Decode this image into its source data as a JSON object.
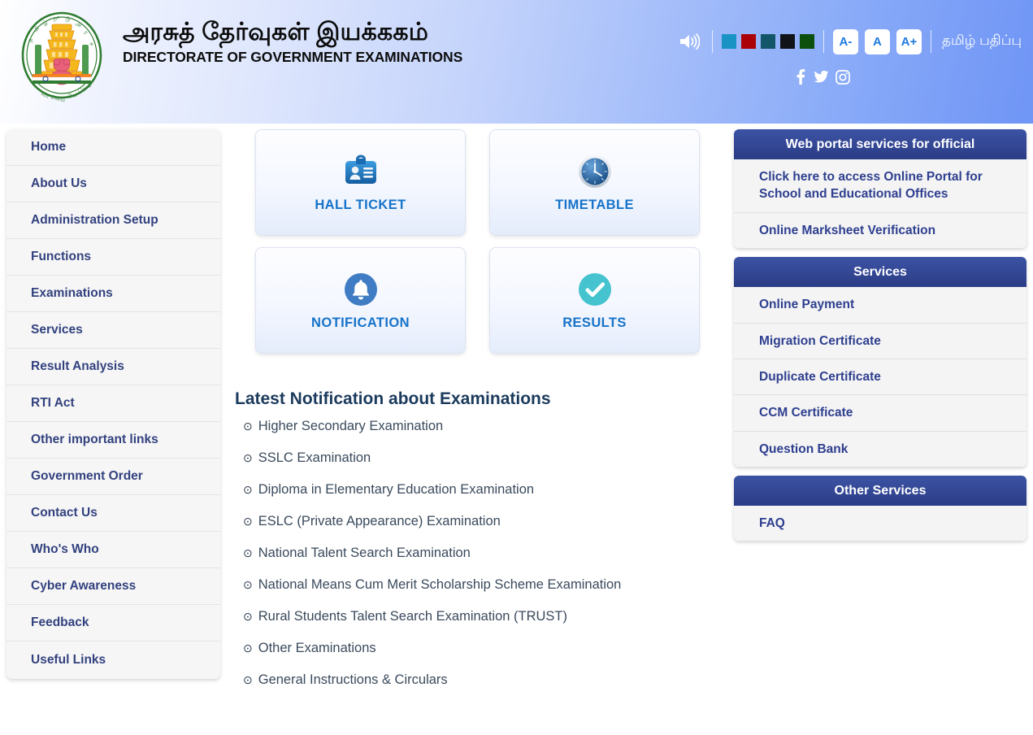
{
  "header": {
    "title_tamil": "அரசுத் தேர்வுகள் இயக்ககம்",
    "title_english": "DIRECTORATE OF GOVERNMENT EXAMINATIONS",
    "logo_alt": "tamil-nadu-government-emblem",
    "speaker_icon": "speaker-icon",
    "theme_swatches": [
      {
        "name": "theme-swatch-cyan",
        "color": "#1993c4"
      },
      {
        "name": "theme-swatch-red",
        "color": "#ab0208"
      },
      {
        "name": "theme-swatch-teal",
        "color": "#135569"
      },
      {
        "name": "theme-swatch-black",
        "color": "#101418"
      },
      {
        "name": "theme-swatch-green",
        "color": "#0d4f0d"
      }
    ],
    "font_buttons": [
      {
        "name": "font-decrease-button",
        "label": "A-"
      },
      {
        "name": "font-normal-button",
        "label": "A"
      },
      {
        "name": "font-increase-button",
        "label": "A+"
      }
    ],
    "language_link": "தமிழ் பதிப்பு",
    "social": [
      {
        "name": "facebook-icon",
        "label": "Facebook"
      },
      {
        "name": "twitter-icon",
        "label": "Twitter"
      },
      {
        "name": "instagram-icon",
        "label": "Instagram"
      }
    ]
  },
  "sidebar": {
    "items": [
      {
        "label": "Home"
      },
      {
        "label": "About Us"
      },
      {
        "label": "Administration Setup"
      },
      {
        "label": "Functions"
      },
      {
        "label": "Examinations"
      },
      {
        "label": "Services"
      },
      {
        "label": "Result Analysis"
      },
      {
        "label": "RTI Act"
      },
      {
        "label": "Other important links"
      },
      {
        "label": "Government Order"
      },
      {
        "label": "Contact Us"
      },
      {
        "label": "Who's Who"
      },
      {
        "label": "Cyber Awareness"
      },
      {
        "label": "Feedback"
      },
      {
        "label": "Useful Links"
      }
    ]
  },
  "tiles": [
    {
      "label": "HALL TICKET",
      "icon": "id-badge-icon"
    },
    {
      "label": "TIMETABLE",
      "icon": "clock-icon"
    },
    {
      "label": "NOTIFICATION",
      "icon": "bell-icon"
    },
    {
      "label": "RESULTS",
      "icon": "check-circle-icon"
    }
  ],
  "notifications": {
    "heading": "Latest Notification about Examinations",
    "items": [
      {
        "label": "Higher Secondary Examination"
      },
      {
        "label": "SSLC Examination"
      },
      {
        "label": "Diploma in Elementary Education Examination"
      },
      {
        "label": "ESLC (Private Appearance) Examination"
      },
      {
        "label": "National Talent Search Examination"
      },
      {
        "label": "National Means Cum Merit Scholarship Scheme Examination"
      },
      {
        "label": "Rural Students Talent Search Examination (TRUST)"
      },
      {
        "label": "Other Examinations"
      },
      {
        "label": "General Instructions & Circulars"
      }
    ]
  },
  "panels": [
    {
      "title": "Web portal services for official",
      "items": [
        {
          "label": "Click here to access Online Portal for School and Educational Offices"
        },
        {
          "label": "Online Marksheet Verification"
        }
      ]
    },
    {
      "title": "Services",
      "items": [
        {
          "label": "Online Payment"
        },
        {
          "label": "Migration Certificate"
        },
        {
          "label": "Duplicate Certificate"
        },
        {
          "label": "CCM Certificate"
        },
        {
          "label": "Question Bank"
        }
      ]
    },
    {
      "title": "Other Services",
      "items": [
        {
          "label": "FAQ"
        }
      ]
    }
  ],
  "colors": {
    "panel_header_blue": "#2b3c86",
    "link_blue": "#2e3f8f",
    "tile_label_blue": "#1673c9",
    "heading_blue": "#1b3a5c"
  }
}
